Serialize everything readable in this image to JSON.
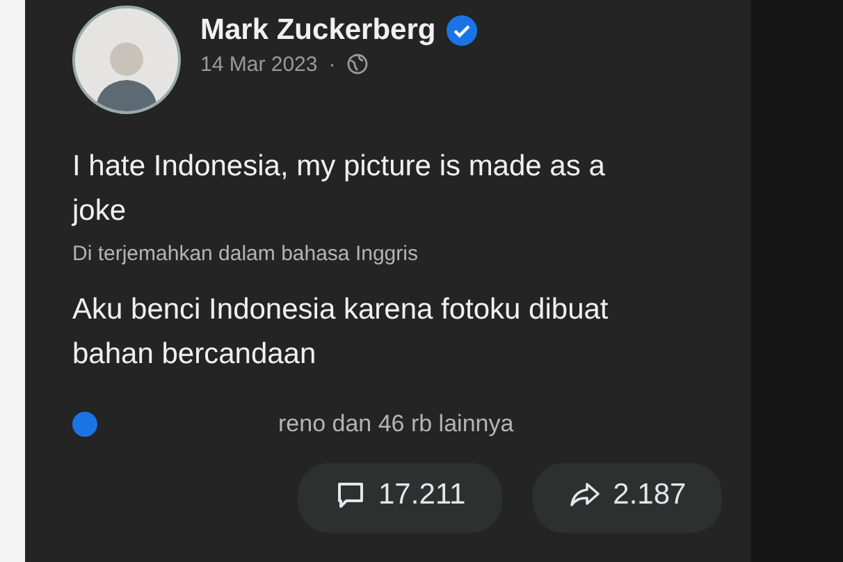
{
  "post": {
    "author": "Mark Zuckerberg",
    "verified": true,
    "date": "14 Mar 2023",
    "separator": "·",
    "text": "I hate Indonesia, my picture is made as a joke",
    "translation_note": "Di terjemahkan dalam bahasa Inggris",
    "translated_text": "Aku benci Indonesia karena fotoku dibuat bahan bercandaan",
    "reactions_summary": "reno dan 46 rb lainnya",
    "actions": [
      {
        "kind": "comment",
        "count": "17.211"
      },
      {
        "kind": "share",
        "count": "2.187"
      }
    ]
  }
}
